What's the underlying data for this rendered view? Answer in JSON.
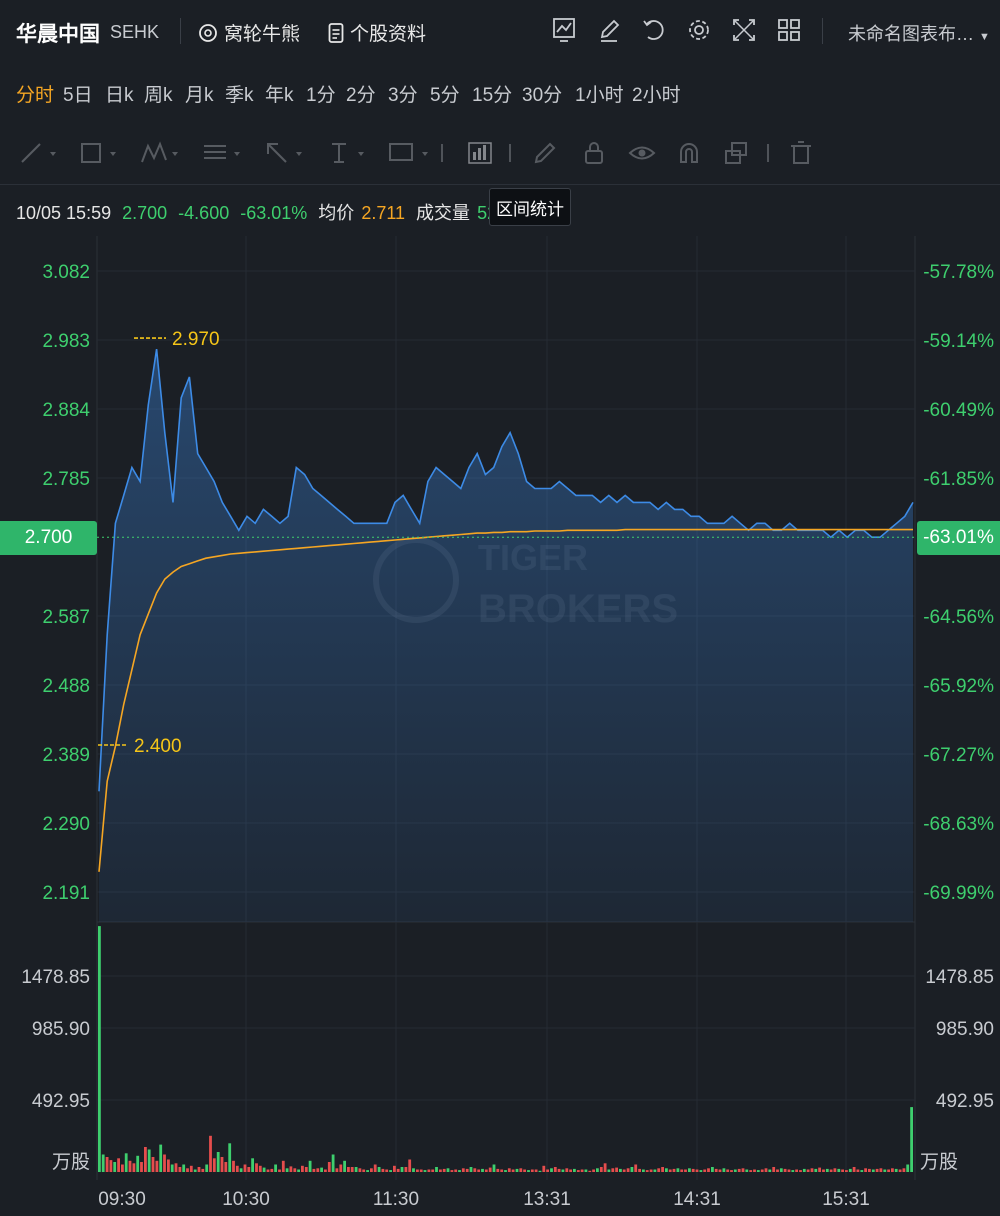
{
  "header": {
    "stock_name": "华晨中国",
    "exchange": "SEHK",
    "warrants_link": "窝轮牛熊",
    "profile_link": "个股资料",
    "layout_name": "未命名图表布…",
    "icons": [
      "chart-settings-icon",
      "pen-icon",
      "replay-icon",
      "gear-icon",
      "fullscreen-icon",
      "grid-layout-icon"
    ]
  },
  "periods": [
    "分时",
    "5日",
    "日k",
    "周k",
    "月k",
    "季k",
    "年k",
    "1分",
    "2分",
    "3分",
    "5分",
    "15分",
    "30分",
    "1小时",
    "2小时"
  ],
  "active_period": "分时",
  "toolbar": {
    "tools": [
      "line-tool-icon",
      "rectangle-tool-icon",
      "pattern-tool-icon",
      "fib-tool-icon",
      "arrow-tool-icon",
      "text-tool-icon",
      "label-tool-icon",
      "range-stats-icon",
      "pencil-icon",
      "lock-icon",
      "eye-icon",
      "magnet-icon",
      "layers-icon",
      "trash-icon"
    ],
    "tooltip": "区间统计"
  },
  "info": {
    "datetime": "10/05 15:59",
    "price": "2.700",
    "change": "-4.600",
    "change_pct": "-63.01%",
    "avg_label": "均价",
    "avg_value": "2.711",
    "volume_label": "成交量",
    "volume_value": "529"
  },
  "badges": {
    "price": "2.700",
    "pct": "-63.01%"
  },
  "watermark": {
    "line1": "TIGER",
    "line2": "BROKERS"
  },
  "colors": {
    "price_line": "#3d8be6",
    "avg_line": "#f5a623",
    "up": "#3ecf6e",
    "down": "#e54d4d",
    "marker": "#f5c518"
  },
  "chart_data": {
    "type": "line",
    "price_axis_labels": [
      "3.082",
      "2.983",
      "2.884",
      "2.785",
      "2.700",
      "2.587",
      "2.488",
      "2.389",
      "2.290",
      "2.191"
    ],
    "pct_axis_labels": [
      "-57.78%",
      "-59.14%",
      "-60.49%",
      "-61.85%",
      "-63.01%",
      "-64.56%",
      "-65.92%",
      "-67.27%",
      "-68.63%",
      "-69.99%"
    ],
    "ylim": [
      2.191,
      3.082
    ],
    "time_labels": [
      "09:30",
      "10:30",
      "11:30",
      "13:31",
      "14:31",
      "15:31"
    ],
    "high_marker": "2.970",
    "low_marker": "2.400",
    "high_value": 2.97,
    "low_value": 2.4,
    "last_price": 2.7,
    "price_series": [
      2.53,
      2.56,
      2.72,
      2.76,
      2.8,
      2.78,
      2.89,
      2.97,
      2.85,
      2.75,
      2.9,
      2.93,
      2.82,
      2.8,
      2.78,
      2.75,
      2.73,
      2.71,
      2.73,
      2.72,
      2.74,
      2.73,
      2.72,
      2.73,
      2.8,
      2.79,
      2.77,
      2.76,
      2.75,
      2.74,
      2.73,
      2.72,
      2.72,
      2.72,
      2.72,
      2.72,
      2.75,
      2.76,
      2.74,
      2.72,
      2.78,
      2.8,
      2.79,
      2.78,
      2.77,
      2.8,
      2.82,
      2.79,
      2.8,
      2.83,
      2.85,
      2.82,
      2.78,
      2.77,
      2.77,
      2.77,
      2.78,
      2.77,
      2.76,
      2.76,
      2.76,
      2.75,
      2.76,
      2.75,
      2.76,
      2.75,
      2.75,
      2.75,
      2.74,
      2.75,
      2.74,
      2.74,
      2.73,
      2.73,
      2.72,
      2.72,
      2.72,
      2.73,
      2.72,
      2.71,
      2.72,
      2.72,
      2.71,
      2.71,
      2.72,
      2.71,
      2.71,
      2.71,
      2.71,
      2.7,
      2.71,
      2.7,
      2.71,
      2.71,
      2.7,
      2.7,
      2.71,
      2.72,
      2.73,
      2.75
    ],
    "avg_series": [
      2.22,
      2.35,
      2.4,
      2.46,
      2.51,
      2.56,
      2.59,
      2.62,
      2.64,
      2.65,
      2.658,
      2.662,
      2.666,
      2.67,
      2.672,
      2.674,
      2.676,
      2.677,
      2.678,
      2.679,
      2.68,
      2.681,
      2.682,
      2.683,
      2.684,
      2.685,
      2.686,
      2.687,
      2.688,
      2.689,
      2.69,
      2.691,
      2.692,
      2.693,
      2.694,
      2.695,
      2.696,
      2.697,
      2.698,
      2.699,
      2.7,
      2.701,
      2.702,
      2.703,
      2.704,
      2.705,
      2.706,
      2.706,
      2.707,
      2.707,
      2.708,
      2.708,
      2.708,
      2.709,
      2.709,
      2.709,
      2.709,
      2.71,
      2.71,
      2.71,
      2.71,
      2.71,
      2.71,
      2.71,
      2.711,
      2.711,
      2.711,
      2.711,
      2.711,
      2.711,
      2.711,
      2.711,
      2.711,
      2.711,
      2.711,
      2.711,
      2.711,
      2.711,
      2.711,
      2.711,
      2.711,
      2.711,
      2.711,
      2.711,
      2.711,
      2.711,
      2.711,
      2.711,
      2.711,
      2.711,
      2.711,
      2.711,
      2.711,
      2.711,
      2.711,
      2.711,
      2.711,
      2.711,
      2.711,
      2.711
    ],
    "volume_axis_labels": [
      "1478.85",
      "985.90",
      "492.95",
      "万股"
    ],
    "volume_max": 1971.8,
    "volume_series": [
      1971,
      140,
      120,
      95,
      80,
      110,
      60,
      150,
      90,
      70,
      130,
      80,
      200,
      180,
      120,
      90,
      220,
      140,
      100,
      60,
      70,
      40,
      60,
      30,
      50,
      20,
      40,
      25,
      60,
      290,
      110,
      160,
      120,
      80,
      230,
      90,
      50,
      30,
      60,
      40,
      110,
      70,
      50,
      35,
      20,
      25,
      60,
      20,
      90,
      30,
      45,
      30,
      20,
      50,
      40,
      90,
      25,
      30,
      35,
      20,
      80,
      140,
      30,
      60,
      90,
      40,
      40,
      40,
      30,
      20,
      15,
      30,
      60,
      40,
      25,
      20,
      15,
      50,
      25,
      40,
      40,
      100,
      30,
      20,
      20,
      15,
      20,
      20,
      40,
      20,
      25,
      30,
      15,
      20,
      15,
      30,
      25,
      40,
      30,
      20,
      25,
      20,
      35,
      60,
      25,
      20,
      15,
      30,
      20,
      25,
      30,
      20,
      15,
      20,
      20,
      10,
      50,
      20,
      30,
      40,
      25,
      20,
      30,
      20,
      25,
      15,
      20,
      20,
      10,
      20,
      30,
      40,
      70,
      20,
      30,
      35,
      25,
      20,
      30,
      40,
      60,
      25,
      20,
      15,
      20,
      20,
      30,
      40,
      30,
      20,
      25,
      30,
      20,
      20,
      30,
      25,
      20,
      15,
      20,
      30,
      40,
      25,
      20,
      30,
      20,
      15,
      20,
      25,
      30,
      20,
      15,
      20,
      15,
      20,
      30,
      20,
      40,
      20,
      30,
      25,
      20,
      15,
      20,
      15,
      25,
      20,
      30,
      25,
      35,
      20,
      25,
      20,
      30,
      25,
      20,
      15,
      25,
      40,
      20,
      15,
      30,
      25,
      20,
      25,
      30,
      20,
      20,
      30,
      25,
      20,
      30,
      60,
      520
    ],
    "volume_colors": "mixed red/green"
  }
}
